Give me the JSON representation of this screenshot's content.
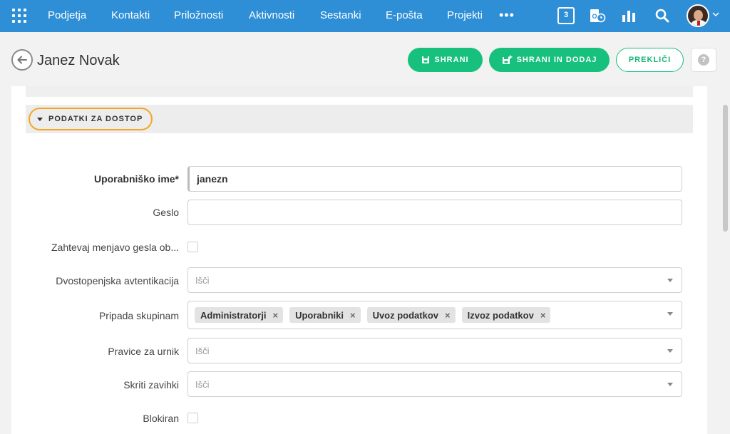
{
  "nav": {
    "items": [
      "Podjetja",
      "Kontakti",
      "Priložnosti",
      "Aktivnosti",
      "Sestanki",
      "E-pošta",
      "Projekti"
    ],
    "more": "•••",
    "calendar_day": "3"
  },
  "header": {
    "title": "Janez Novak",
    "save_label": "SHRANI",
    "save_add_label": "SHRANI IN DODAJ",
    "cancel_label": "PREKLIČI",
    "help": "?"
  },
  "section": {
    "title": "PODATKI ZA DOSTOP"
  },
  "form": {
    "username_label": "Uporabniško ime*",
    "username_value": "janezn",
    "password_label": "Geslo",
    "password_value": "",
    "require_change_label": "Zahtevaj menjavo gesla ob...",
    "two_factor_label": "Dvostopenjska avtentikacija",
    "two_factor_placeholder": "Išči",
    "groups_label": "Pripada skupinam",
    "groups": [
      "Administratorji",
      "Uporabniki",
      "Uvoz podatkov",
      "Izvoz podatkov"
    ],
    "schedule_rights_label": "Pravice za urnik",
    "schedule_rights_placeholder": "Išči",
    "hidden_tabs_label": "Skriti zavihki",
    "hidden_tabs_placeholder": "Išči",
    "blocked_label": "Blokiran",
    "tag_remove": "×"
  },
  "colors": {
    "nav_bg": "#2f8fd6",
    "accent_green": "#17c07c",
    "highlight": "#f4a623"
  }
}
